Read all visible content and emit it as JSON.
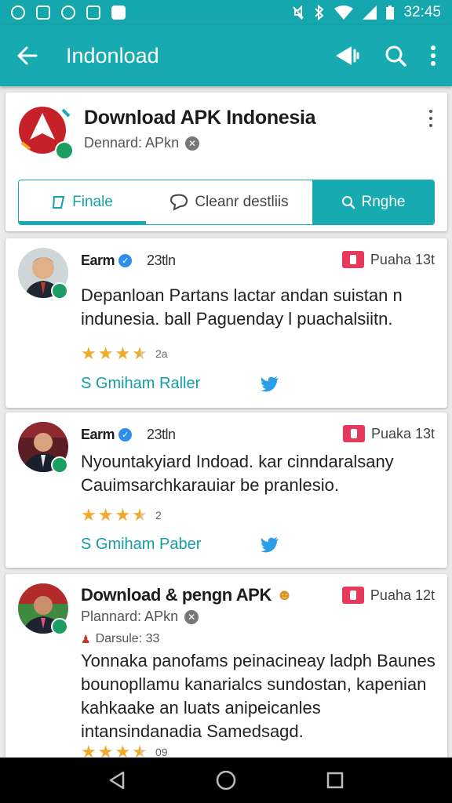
{
  "statusbar": {
    "time": "32:45"
  },
  "appbar": {
    "title": "Indonload"
  },
  "app": {
    "title": "Download APK Indonesia",
    "developer": "Dennard: APkn",
    "tabs": [
      {
        "label": "Finale"
      },
      {
        "label": "Cleanr destliis"
      },
      {
        "label": "Rnghe"
      }
    ]
  },
  "reviews": [
    {
      "name": "Earm",
      "time": "23tln",
      "tag": "Puaha 13t",
      "text": "Depanloan Partans lactar andan suistan n indunesia. ball Paguenday l puachalsiitn.",
      "rating": 3.5,
      "rating_count": "2a",
      "link": "S Gmiham Raller"
    },
    {
      "name": "Earm",
      "time": "23tln",
      "tag": "Puaka 13t",
      "text": "Nyountakyiard Indoad. kar cinndaralsany Cauimsarchkarauiar be pranlesio.",
      "rating": 3.5,
      "rating_count": "2",
      "link": "S Gmiham Paber"
    },
    {
      "name": "Download & pengn APK",
      "developer": "Plannard: APkn",
      "size": "Darsule: 33",
      "tag": "Puaha 12t",
      "text": "Yonnaka panofams peinacineay ladph Baunes bounopllamu kanarialcs sundostan, kapenian kahkaake an luats anipeicanles intansindanadia Samedsagd.",
      "rating": 3.5,
      "rating_count": "09"
    }
  ],
  "colors": {
    "primary": "#17aab1",
    "accent_pink": "#e7395d",
    "star": "#f0a92a",
    "link": "#139ea5"
  }
}
